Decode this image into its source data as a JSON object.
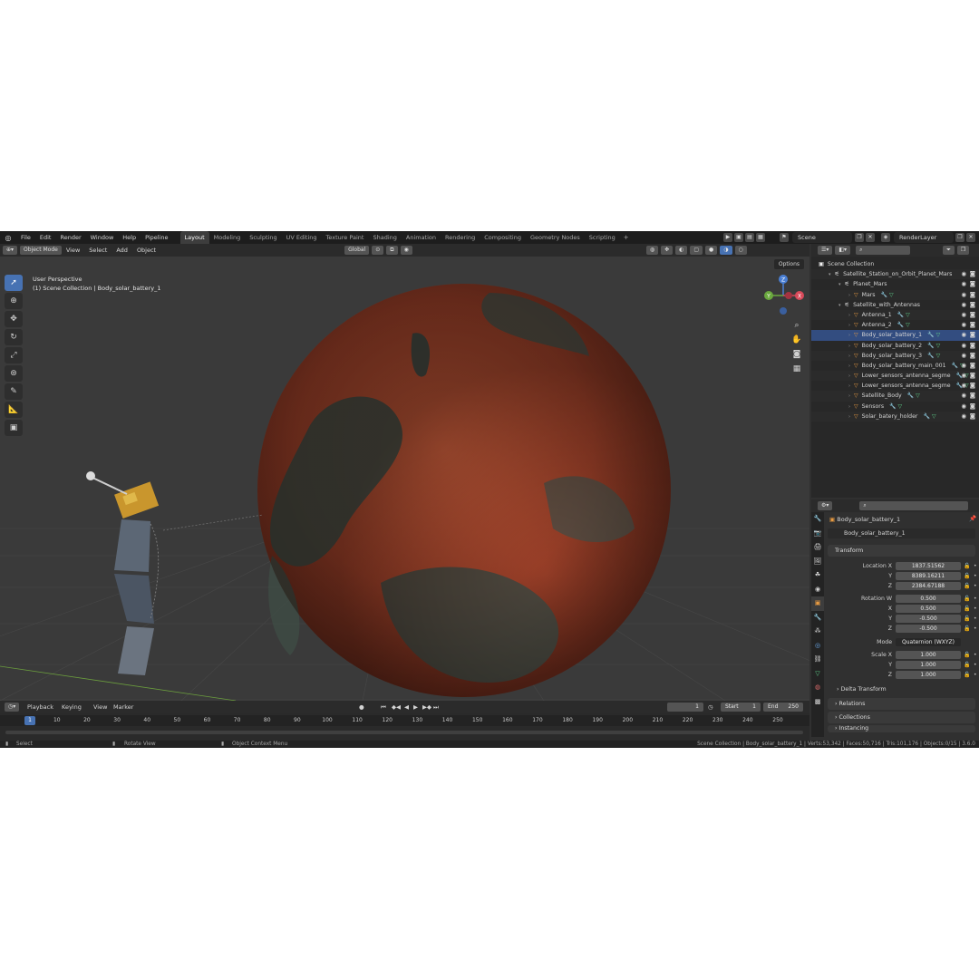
{
  "menu": [
    "File",
    "Edit",
    "Render",
    "Window",
    "Help",
    "Pipeline"
  ],
  "workspaces": [
    "Layout",
    "Modeling",
    "Sculpting",
    "UV Editing",
    "Texture Paint",
    "Shading",
    "Animation",
    "Rendering",
    "Compositing",
    "Geometry Nodes",
    "Scripting"
  ],
  "active_workspace": "Layout",
  "scene_name": "Scene",
  "view_layer": "RenderLayer",
  "viewport_header": {
    "mode": "Object Mode",
    "menus": [
      "View",
      "Select",
      "Add",
      "Object"
    ],
    "orientation": "Global",
    "options": "Options"
  },
  "viewport": {
    "perspective": "User Perspective",
    "collection_info": "(1) Scene Collection | Body_solar_battery_1",
    "gizmo_axes": [
      "Y",
      "X",
      "Z"
    ]
  },
  "outliner": {
    "root": "Scene Collection",
    "items": [
      {
        "label": "Satellite_Station_on_Orbit_Planet_Mars",
        "depth": 1,
        "kind": "collection"
      },
      {
        "label": "Planet_Mars",
        "depth": 2,
        "kind": "collection"
      },
      {
        "label": "Mars",
        "depth": 3,
        "kind": "mesh"
      },
      {
        "label": "Satellite_with_Antennas",
        "depth": 2,
        "kind": "collection"
      },
      {
        "label": "Antenna_1",
        "depth": 3,
        "kind": "mesh"
      },
      {
        "label": "Antenna_2",
        "depth": 3,
        "kind": "mesh"
      },
      {
        "label": "Body_solar_battery_1",
        "depth": 3,
        "kind": "mesh",
        "selected": true
      },
      {
        "label": "Body_solar_battery_2",
        "depth": 3,
        "kind": "mesh"
      },
      {
        "label": "Body_solar_battery_3",
        "depth": 3,
        "kind": "mesh"
      },
      {
        "label": "Body_solar_battery_main_001",
        "depth": 3,
        "kind": "mesh"
      },
      {
        "label": "Lower_sensors_antenna_segme",
        "depth": 3,
        "kind": "mesh"
      },
      {
        "label": "Lower_sensors_antenna_segme",
        "depth": 3,
        "kind": "mesh"
      },
      {
        "label": "Satellite_Body",
        "depth": 3,
        "kind": "mesh"
      },
      {
        "label": "Sensors",
        "depth": 3,
        "kind": "mesh"
      },
      {
        "label": "Solar_batery_holder",
        "depth": 3,
        "kind": "mesh"
      }
    ]
  },
  "properties": {
    "object_name": "Body_solar_battery_1",
    "object_field": "Body_solar_battery_1",
    "transform_label": "Transform",
    "location": {
      "label": "Location X",
      "x": "1837.51562",
      "y": "8389.16211",
      "z": "2384.67188"
    },
    "rotation": {
      "label": "Rotation W",
      "w": "0.500",
      "x": "0.500",
      "y": "-0.500",
      "z": "-0.500"
    },
    "mode_label": "Mode",
    "mode_value": "Quaternion (WXYZ)",
    "scale": {
      "label": "Scale X",
      "x": "1.000",
      "y": "1.000",
      "z": "1.000"
    },
    "axis": {
      "x": "X",
      "y": "Y",
      "z": "Z"
    },
    "delta_transform": "Delta Transform",
    "relations": "Relations",
    "collections": "Collections",
    "instancing": "Instancing"
  },
  "timeline": {
    "menus": [
      "Playback",
      "Keying",
      "View",
      "Marker"
    ],
    "current_frame": "1",
    "start_label": "Start",
    "start": "1",
    "end_label": "End",
    "end": "250",
    "ticks": [
      "1",
      "10",
      "20",
      "30",
      "40",
      "50",
      "60",
      "70",
      "80",
      "90",
      "100",
      "110",
      "120",
      "130",
      "140",
      "150",
      "160",
      "170",
      "180",
      "190",
      "200",
      "210",
      "220",
      "230",
      "240",
      "250"
    ]
  },
  "statusbar": {
    "select": "Select",
    "rotate": "Rotate View",
    "context": "Object Context Menu",
    "stats": "Scene Collection | Body_solar_battery_1 | Verts:53,342 | Faces:50,716 | Tris:101,176 | Objects:0/15 | 3.6.0"
  },
  "colors": {
    "accent": "#4772b3",
    "mars": "#b0482e",
    "selection": "#e89b42"
  }
}
